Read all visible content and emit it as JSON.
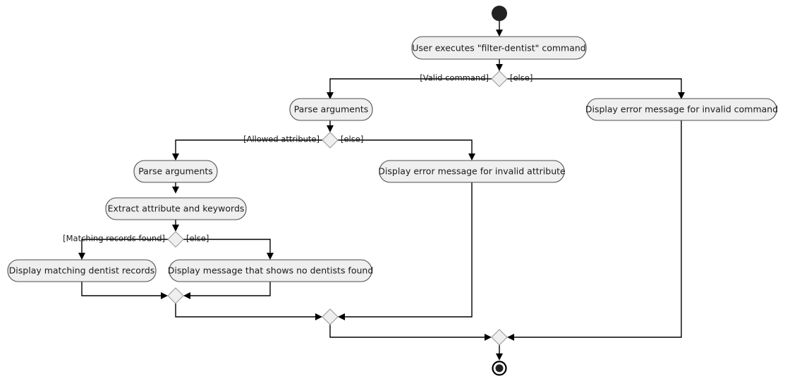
{
  "diagram": {
    "type": "uml-activity-diagram",
    "background_color": "#ffffff",
    "node_fill_color": "#efefef",
    "node_border_color": "#4d4d4d",
    "line_color": "#000000",
    "start_node": {
      "label": "start"
    },
    "end_node": {
      "label": "end"
    },
    "activities": {
      "user_executes": "User executes \"filter-dentist\" command",
      "parse_arguments_1": "Parse arguments",
      "invalid_command": "Display error message for invalid command",
      "parse_arguments_2": "Parse arguments",
      "invalid_attribute": "Display error message for invalid attribute",
      "extract_attribute": "Extract attribute and keywords",
      "matching_records": "Display matching dentist records",
      "no_dentists": "Display message that shows no dentists found"
    },
    "guards": {
      "valid_command": "[Valid command]",
      "valid_command_else": "[else]",
      "allowed_attribute": "[Allowed attribute]",
      "allowed_attribute_else": "[else]",
      "matching_records_found": "[Matching records found]",
      "matching_records_else": "[else]"
    },
    "decisions": [
      {
        "name": "command-validity-decision"
      },
      {
        "name": "attribute-validity-decision"
      },
      {
        "name": "records-found-decision"
      }
    ],
    "merges": [
      {
        "name": "records-merge"
      },
      {
        "name": "attribute-merge"
      },
      {
        "name": "command-merge"
      }
    ]
  }
}
